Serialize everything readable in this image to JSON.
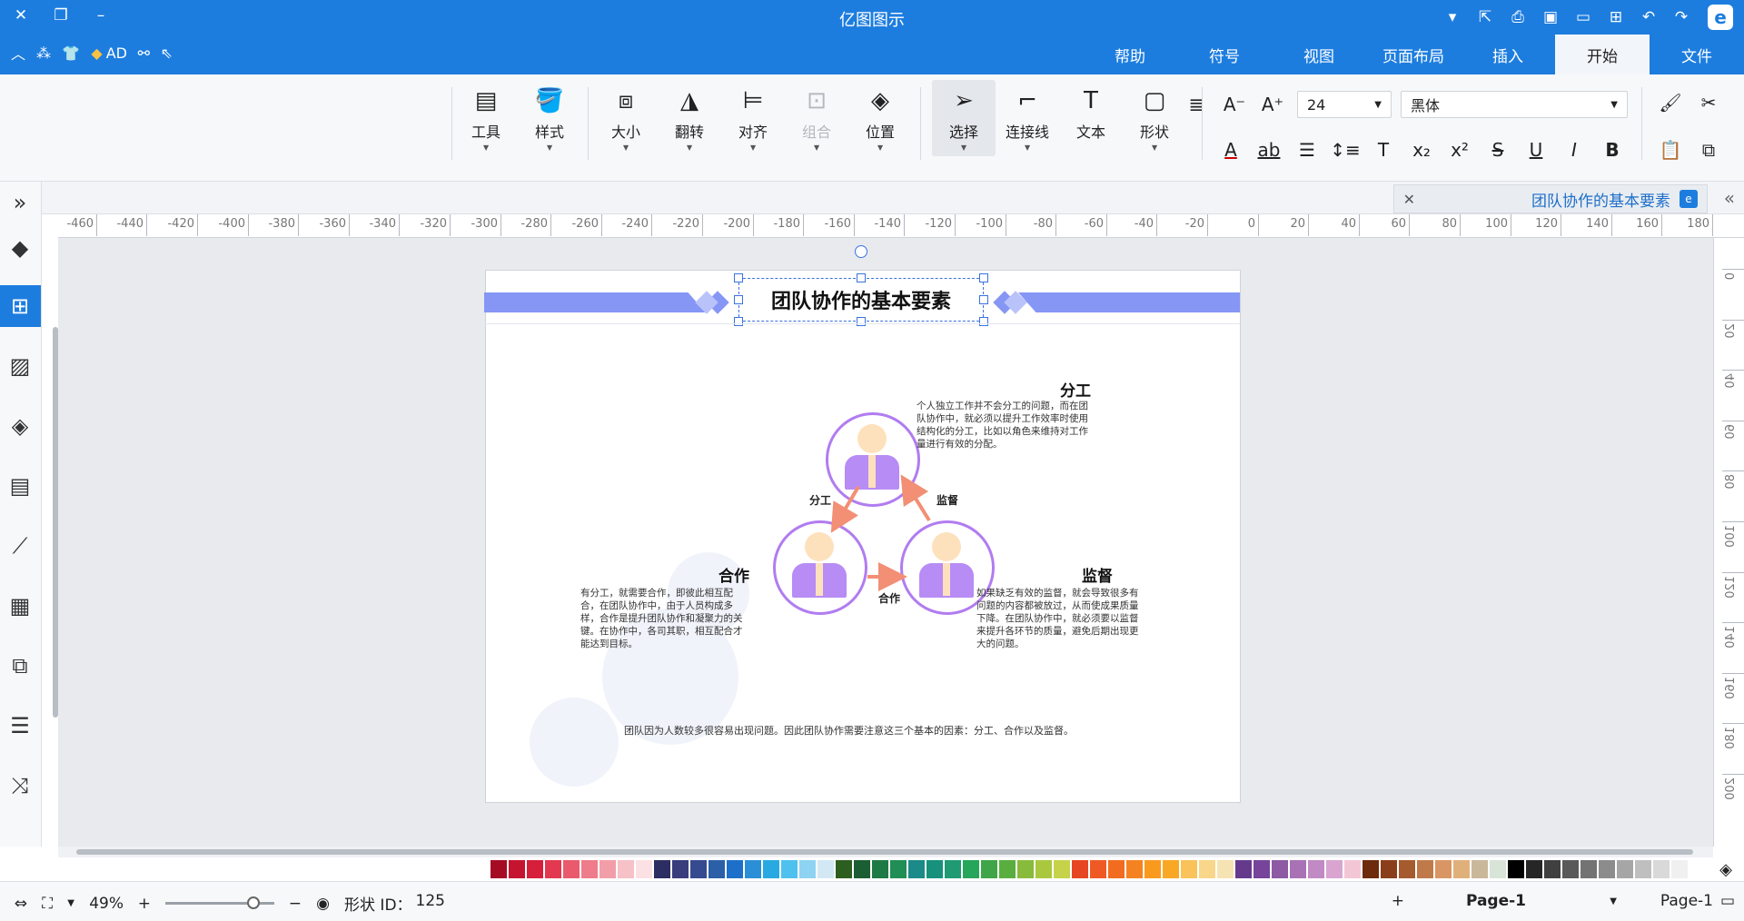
{
  "app": {
    "title": "亿图图示"
  },
  "menu": {
    "tabs": [
      {
        "label": "文件"
      },
      {
        "label": "开始"
      },
      {
        "label": "插入"
      },
      {
        "label": "页面布局"
      },
      {
        "label": "视图"
      },
      {
        "label": "符号"
      },
      {
        "label": "帮助"
      }
    ],
    "active_tab": "开始",
    "ad_label": "AD"
  },
  "ribbon": {
    "font_name": "黑体",
    "font_size": "24",
    "large_buttons": [
      {
        "label": "形状",
        "icon": "square-icon"
      },
      {
        "label": "文本",
        "icon": "text-T-icon"
      },
      {
        "label": "连接线",
        "icon": "connector-icon"
      },
      {
        "label": "选择",
        "icon": "pointer-icon"
      },
      {
        "label": "位置",
        "icon": "layers-icon"
      },
      {
        "label": "组合",
        "icon": "group-icon"
      },
      {
        "label": "对齐",
        "icon": "align-icon"
      },
      {
        "label": "翻转",
        "icon": "flip-icon"
      },
      {
        "label": "大小",
        "icon": "size-icon"
      },
      {
        "label": "样式",
        "icon": "fill-bucket-icon"
      },
      {
        "label": "工具",
        "icon": "tools-icon"
      }
    ]
  },
  "document": {
    "tab_title": "团队协作的基本要素"
  },
  "ruler": {
    "h_ticks": [
      "180",
      "160",
      "140",
      "120",
      "100",
      "80",
      "60",
      "40",
      "20",
      "0",
      "-20",
      "-40",
      "-60",
      "-80",
      "-100",
      "-120",
      "-140",
      "-160",
      "-180",
      "-200",
      "-220",
      "-240",
      "-260",
      "-280",
      "-300",
      "-320",
      "-340",
      "-360",
      "-380",
      "-400",
      "-420",
      "-440",
      "-460"
    ],
    "v_ticks": [
      "0",
      "20",
      "40",
      "60",
      "80",
      "100",
      "120",
      "140",
      "160",
      "180",
      "200"
    ]
  },
  "diagram": {
    "title": "团队协作的基本要素",
    "top_label": "分工",
    "top_desc": "个人独立工作并不会分工的问题，而在团队协作中，就必须以提升工作效率时使用结构化的分工，比如以角色来维持对工作量进行有效的分配。",
    "left_label": "合作",
    "left_desc": "有分工，就需要合作，即彼此相互配合，在团队协作中，由于人员构成多样，合作是提升团队协作和凝聚力的关键。在协作中，各司其职，相互配合才能达到目标。",
    "right_label": "监督",
    "right_desc": "如果缺乏有效的监督，就会导致很多有问题的内容都被放过，从而使成果质量下降。在团队协作中，就必须要以监督来提升各环节的质量，避免后期出现更大的问题。",
    "arrow_label_left": "分工",
    "arrow_label_right": "监督",
    "arrow_label_bottom": "合作",
    "footer": "团队因为人数较多很容易出现问题。因此团队协作需要注意这三个基本的因素：分工、合作以及监督。"
  },
  "palette": {
    "colors": [
      "#ffffff",
      "#f0f0f0",
      "#d9d9d9",
      "#bfbfbf",
      "#a6a6a6",
      "#8c8c8c",
      "#737373",
      "#595959",
      "#404040",
      "#262626",
      "#000000",
      "#d8e4d8",
      "#c9b89a",
      "#e0b07a",
      "#d99563",
      "#c07a49",
      "#a55b2e",
      "#8a3f1a",
      "#6e2a0c",
      "#f3c6d6",
      "#d9a5d0",
      "#c18ac4",
      "#a872b5",
      "#8d5aa3",
      "#76449a",
      "#653a8c",
      "#f5e3b3",
      "#f8d68a",
      "#fac25a",
      "#f9a825",
      "#f99a1e",
      "#f58220",
      "#f26c1f",
      "#ef5a24",
      "#e74622",
      "#c6d34a",
      "#a9c83d",
      "#88bb3b",
      "#5aae3f",
      "#3fa548",
      "#26a65a",
      "#1f9a72",
      "#17907c",
      "#1b8a88",
      "#208e55",
      "#1e7a45",
      "#1b5e33",
      "#2c5e1f",
      "#d3e8f5",
      "#8fd3f2",
      "#4fc1ee",
      "#29a9e1",
      "#2a8fd6",
      "#1d6fc9",
      "#2b5fa8",
      "#354a8f",
      "#3a3d7c",
      "#2c2d62",
      "#fbe1e4",
      "#f6c1c7",
      "#f29ea8",
      "#ee7c8a",
      "#e85a6c",
      "#e23850",
      "#d61f3a",
      "#c5142f",
      "#a50c24"
    ]
  },
  "status": {
    "page_selector": "Page-1",
    "page_tab": "Page-1",
    "shape_id_label": "形状 ID：",
    "shape_id": "125",
    "zoom": "49%"
  }
}
